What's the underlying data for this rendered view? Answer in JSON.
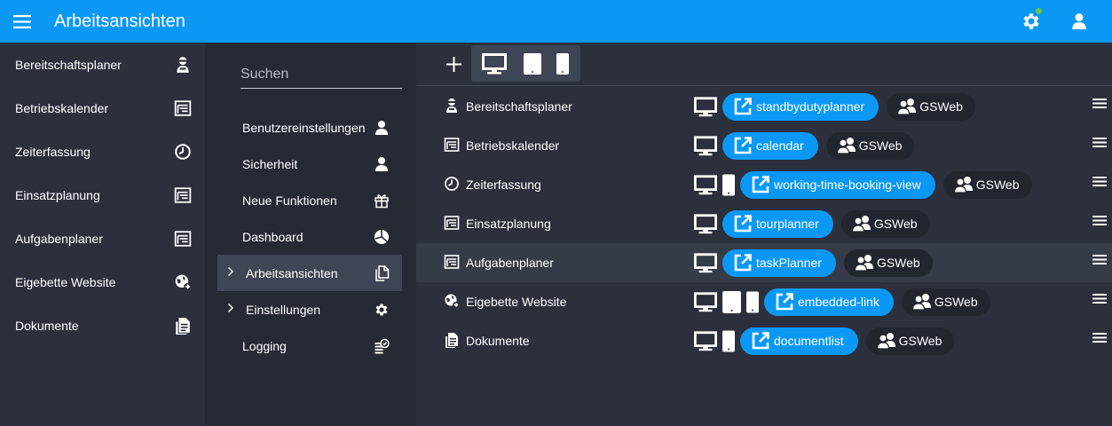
{
  "header": {
    "title": "Arbeitsansichten",
    "menu_icon": "hamburger-icon",
    "settings_icon": "gear-icon",
    "account_icon": "user-icon",
    "status_color": "#66c93a"
  },
  "colors": {
    "accent": "#0b98f5",
    "sidebar_bg": "#2b303c",
    "panel_bg": "#262a35",
    "active_bg": "#3f4554"
  },
  "sidebar": {
    "items": [
      {
        "label": "Bereitschaftsplaner",
        "icon": "standby-person-icon"
      },
      {
        "label": "Betriebskalender",
        "icon": "calendar-list-icon"
      },
      {
        "label": "Zeiterfassung",
        "icon": "clock-icon"
      },
      {
        "label": "Einsatzplanung",
        "icon": "calendar-list-icon"
      },
      {
        "label": "Aufgabenplaner",
        "icon": "calendar-list-icon"
      },
      {
        "label": "Eigebette Website",
        "icon": "globe-link-icon"
      },
      {
        "label": "Dokumente",
        "icon": "documents-icon"
      }
    ]
  },
  "settings_panel": {
    "search_placeholder": "Suchen",
    "items": [
      {
        "label": "Benutzereinstellungen",
        "icon": "user-icon"
      },
      {
        "label": "Sicherheit",
        "icon": "user-icon"
      },
      {
        "label": "Neue Funktionen",
        "icon": "gift-icon"
      },
      {
        "label": "Dashboard",
        "icon": "pie-chart-icon"
      },
      {
        "label": "Arbeitsansichten",
        "icon": "copy-docs-icon",
        "active": true,
        "expandable": true
      },
      {
        "label": "Einstellungen",
        "icon": "gear-icon",
        "expandable": true
      },
      {
        "label": "Logging",
        "icon": "log-icon"
      }
    ]
  },
  "toolbar": {
    "add_icon": "plus-icon",
    "device_filters": [
      "desktop-icon",
      "tablet-icon",
      "phone-icon"
    ]
  },
  "views": [
    {
      "label": "Bereitschaftsplaner",
      "icon": "standby-person-icon",
      "devices": [
        "desktop"
      ],
      "link": "standbydutyplanner",
      "group": "GSWeb"
    },
    {
      "label": "Betriebskalender",
      "icon": "calendar-list-icon",
      "devices": [
        "desktop"
      ],
      "link": "calendar",
      "group": "GSWeb"
    },
    {
      "label": "Zeiterfassung",
      "icon": "clock-icon",
      "devices": [
        "desktop",
        "phone"
      ],
      "link": "working-time-booking-view",
      "group": "GSWeb"
    },
    {
      "label": "Einsatzplanung",
      "icon": "calendar-list-icon",
      "devices": [
        "desktop"
      ],
      "link": "tourplanner",
      "group": "GSWeb"
    },
    {
      "label": "Aufgabenplaner",
      "icon": "calendar-list-icon",
      "devices": [
        "desktop"
      ],
      "link": "taskPlanner",
      "group": "GSWeb",
      "highlighted": true
    },
    {
      "label": "Eigebette Website",
      "icon": "globe-link-icon",
      "devices": [
        "desktop",
        "tablet",
        "phone"
      ],
      "link": "embedded-link",
      "group": "GSWeb"
    },
    {
      "label": "Dokumente",
      "icon": "documents-icon",
      "devices": [
        "desktop",
        "phone"
      ],
      "link": "documentlist",
      "group": "GSWeb"
    }
  ]
}
